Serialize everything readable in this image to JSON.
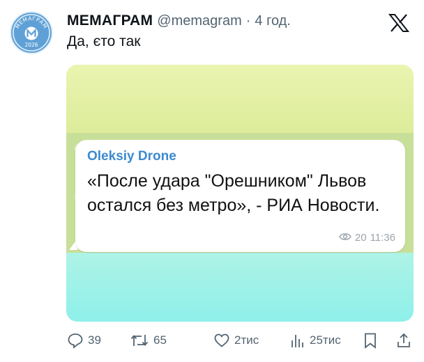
{
  "tweet": {
    "author_name": "МЕМАГРАМ",
    "handle": "@memagram",
    "separator": "·",
    "time": "4 год.",
    "text": "Да, єто так"
  },
  "avatar": {
    "arc_text": "МЕМАГРАМ",
    "year": "2026",
    "color": "#63a6d9"
  },
  "message_card": {
    "sender": "Oleksiy Drone",
    "text": "«После удара \"Орешником\" Львов остался без метро», - РИА Новости.",
    "views": "20",
    "time": "11:36",
    "sender_color": "#3c8ad0"
  },
  "actions": {
    "replies": "39",
    "reposts": "65",
    "likes": "2тис",
    "views": "25тис"
  },
  "icons": [
    "x-logo-icon",
    "reply-icon",
    "repost-icon",
    "like-icon",
    "views-icon",
    "bookmark-icon",
    "share-icon",
    "eye-icon"
  ]
}
